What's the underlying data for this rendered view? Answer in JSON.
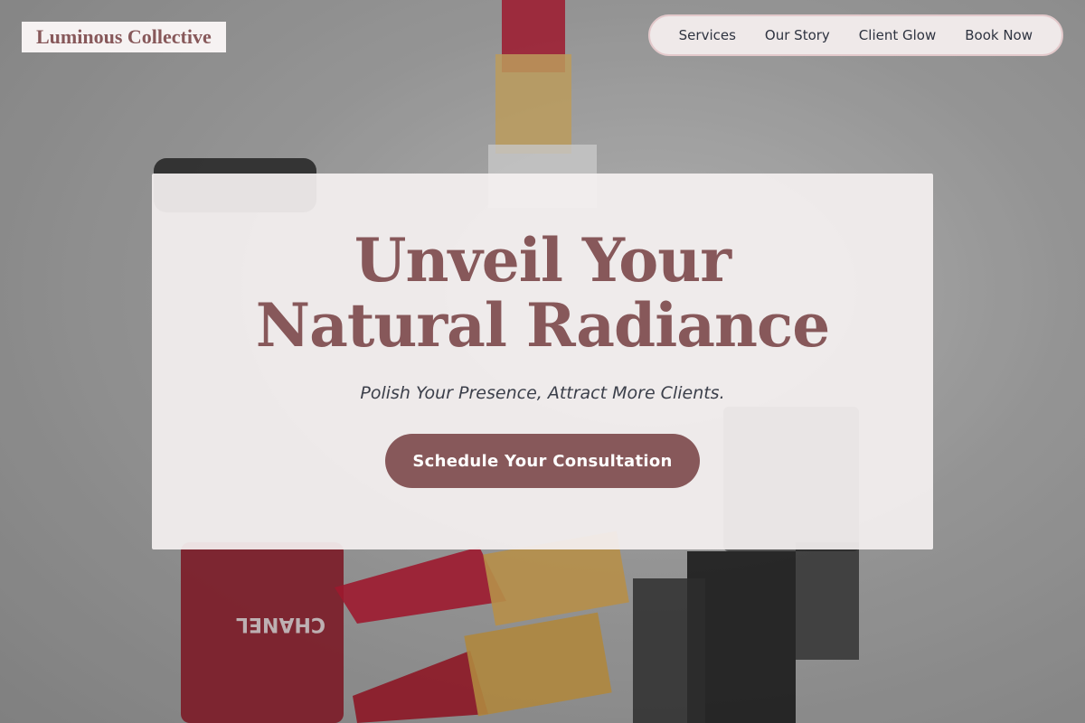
{
  "header": {
    "logo_text": "Luminous Collective",
    "nav": [
      {
        "label": "Services"
      },
      {
        "label": "Our Story"
      },
      {
        "label": "Client Glow"
      },
      {
        "label": "Book Now"
      }
    ]
  },
  "hero": {
    "title": "Unveil Your Natural Radiance",
    "subtitle": "Polish Your Presence, Attract More Clients.",
    "cta_label": "Schedule Your Consultation",
    "background_image_text": [
      "CHANEL"
    ]
  },
  "colors": {
    "brand": "#87585a",
    "nav_text": "#2e3340",
    "card_bg": "#f4f0f0",
    "lipstick_red": "#b3122b",
    "gold": "#c9a24a"
  }
}
